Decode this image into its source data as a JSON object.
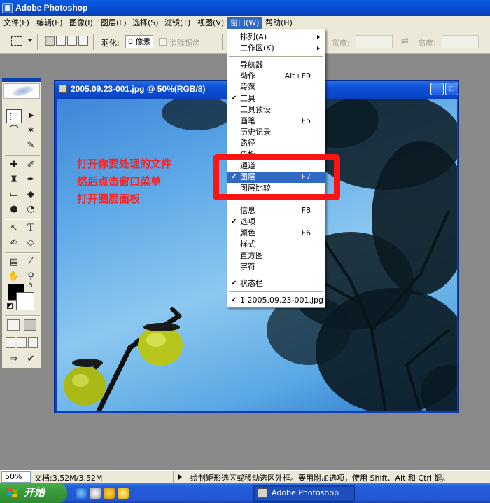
{
  "window": {
    "title": "Adobe Photoshop"
  },
  "menubar": {
    "items": [
      "文件(F)",
      "编辑(E)",
      "图像(I)",
      "图层(L)",
      "选择(S)",
      "滤镜(T)",
      "视图(V)",
      "窗口(W)",
      "帮助(H)"
    ],
    "active_item": "窗口(W)"
  },
  "options": {
    "feather_label": "羽化:",
    "feather_value": "0 像素",
    "antialias_label": "消除锯齿",
    "width_label": "宽度:",
    "height_label": "高度:"
  },
  "document": {
    "title": "2005.09.23-001.jpg @ 50%(RGB/8)"
  },
  "annotation": {
    "lines": [
      "打开你要处理的文件",
      "然后点击窗口菜单",
      "打开图层面板"
    ]
  },
  "window_menu": {
    "items": [
      {
        "label": "排列(A)",
        "submenu": true
      },
      {
        "label": "工作区(K)",
        "submenu": true
      },
      {
        "label": "导航器"
      },
      {
        "label": "动作",
        "shortcut": "Alt+F9"
      },
      {
        "label": "段落"
      },
      {
        "label": "工具",
        "checked": true
      },
      {
        "label": "工具预设"
      },
      {
        "label": "画笔",
        "shortcut": "F5"
      },
      {
        "label": "历史记录"
      },
      {
        "label": "路径"
      },
      {
        "label": "色板"
      },
      {
        "label": "通道"
      },
      {
        "label": "图层",
        "shortcut": "F7",
        "checked": true,
        "highlighted": true
      },
      {
        "label": "图层比较"
      },
      {
        "label": "信息",
        "shortcut": "F8"
      },
      {
        "label": "选项",
        "checked": true
      },
      {
        "label": "颜色",
        "shortcut": "F6"
      },
      {
        "label": "样式"
      },
      {
        "label": "直方图"
      },
      {
        "label": "字符"
      },
      {
        "label": "状态栏",
        "checked": true
      },
      {
        "label": "1 2005.09.23-001.jpg"
      }
    ]
  },
  "statusbar": {
    "zoom": "50%",
    "doc_info": "文档:3.52M/3.52M",
    "hint": "绘制矩形选区或移动选区外框。要用附加选项，使用 Shift、Alt 和 Ctrl 键。"
  },
  "taskbar": {
    "start_label": "开始",
    "task_label": "Adobe Photoshop"
  }
}
